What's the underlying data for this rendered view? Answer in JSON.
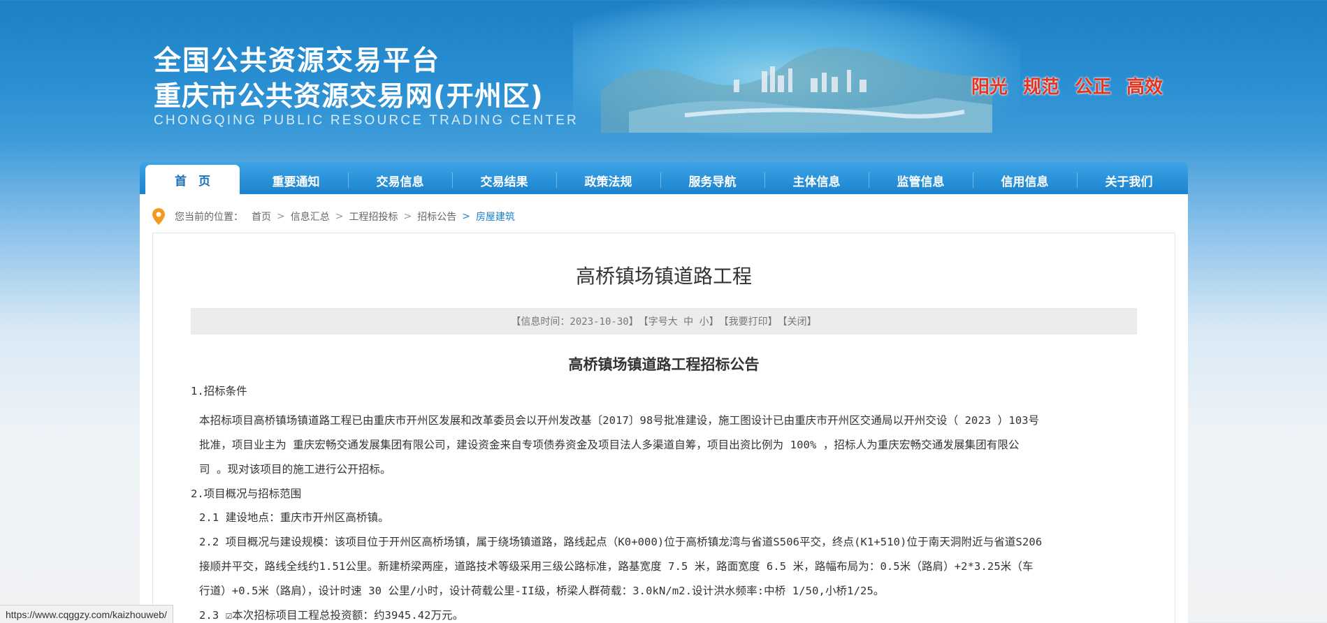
{
  "header": {
    "title_line1": "全国公共资源交易平台",
    "title_line2": "重庆市公共资源交易网(开州区)",
    "title_en": "CHONGQING PUBLIC RESOURCE TRADING CENTER",
    "slogan": [
      "阳光",
      "规范",
      "公正",
      "高效"
    ]
  },
  "nav": {
    "items": [
      "首　页",
      "重要通知",
      "交易信息",
      "交易结果",
      "政策法规",
      "服务导航",
      "主体信息",
      "监管信息",
      "信用信息",
      "关于我们"
    ],
    "active_index": 0
  },
  "breadcrumb": {
    "label": "您当前的位置：",
    "items": [
      "首页",
      "信息汇总",
      "工程招投标",
      "招标公告"
    ],
    "current": "房屋建筑"
  },
  "article": {
    "title": "高桥镇场镇道路工程",
    "meta": {
      "time": "【信息时间：2023-10-30】",
      "font_prefix": "【字号 ",
      "font_large": "大",
      "font_medium": "中",
      "font_small": "小",
      "font_suffix": "】",
      "print": "【我要打印】",
      "close": "【关闭】"
    },
    "subtitle": "高桥镇场镇道路工程招标公告",
    "section1_heading": "1.招标条件",
    "section1_lines": [
      "本招标项目高桥镇场镇道路工程已由重庆市开州区发展和改革委员会以开州发改基〔2017〕98号批准建设，施工图设计已由重庆市开州区交通局以开州交设（ 2023 ）103号",
      "批准，项目业主为 重庆宏畅交通发展集团有限公司，建设资金来自专项债券资金及项目法人多渠道自筹，项目出资比例为 100% ，招标人为重庆宏畅交通发展集团有限公",
      "司 。现对该项目的施工进行公开招标。"
    ],
    "section2_heading": "2.项目概况与招标范围",
    "section2_lines": [
      "2.1 建设地点：重庆市开州区高桥镇。",
      "2.2 项目概况与建设规模：该项目位于开州区高桥场镇，属于绕场镇道路，路线起点（K0+000)位于高桥镇龙湾与省道S506平交，终点(K1+510)位于南天洞附近与省道S206",
      "接顺并平交，路线全线约1.51公里。新建桥梁两座，道路技术等级采用三级公路标准，路基宽度 7.5 米，路面宽度 6.5 米，路幅布局为：0.5米（路肩）+2*3.25米（车",
      "行道）+0.5米（路肩），设计时速 30 公里/小时，设计荷载公里-II级，桥梁人群荷载：3.0kN/m2.设计洪水频率:中桥 1/50,小桥1/25。",
      "2.3 ☑本次招标项目工程总投资额：约3945.42万元。"
    ]
  },
  "status_bar": {
    "url": "https://www.cqggzy.com/kaizhouweb/"
  },
  "colors": {
    "nav_blue": "#1b83cf",
    "slogan_red": "#e8321d",
    "crumb_current": "#1b83cf",
    "pin_orange": "#f39a1e"
  }
}
